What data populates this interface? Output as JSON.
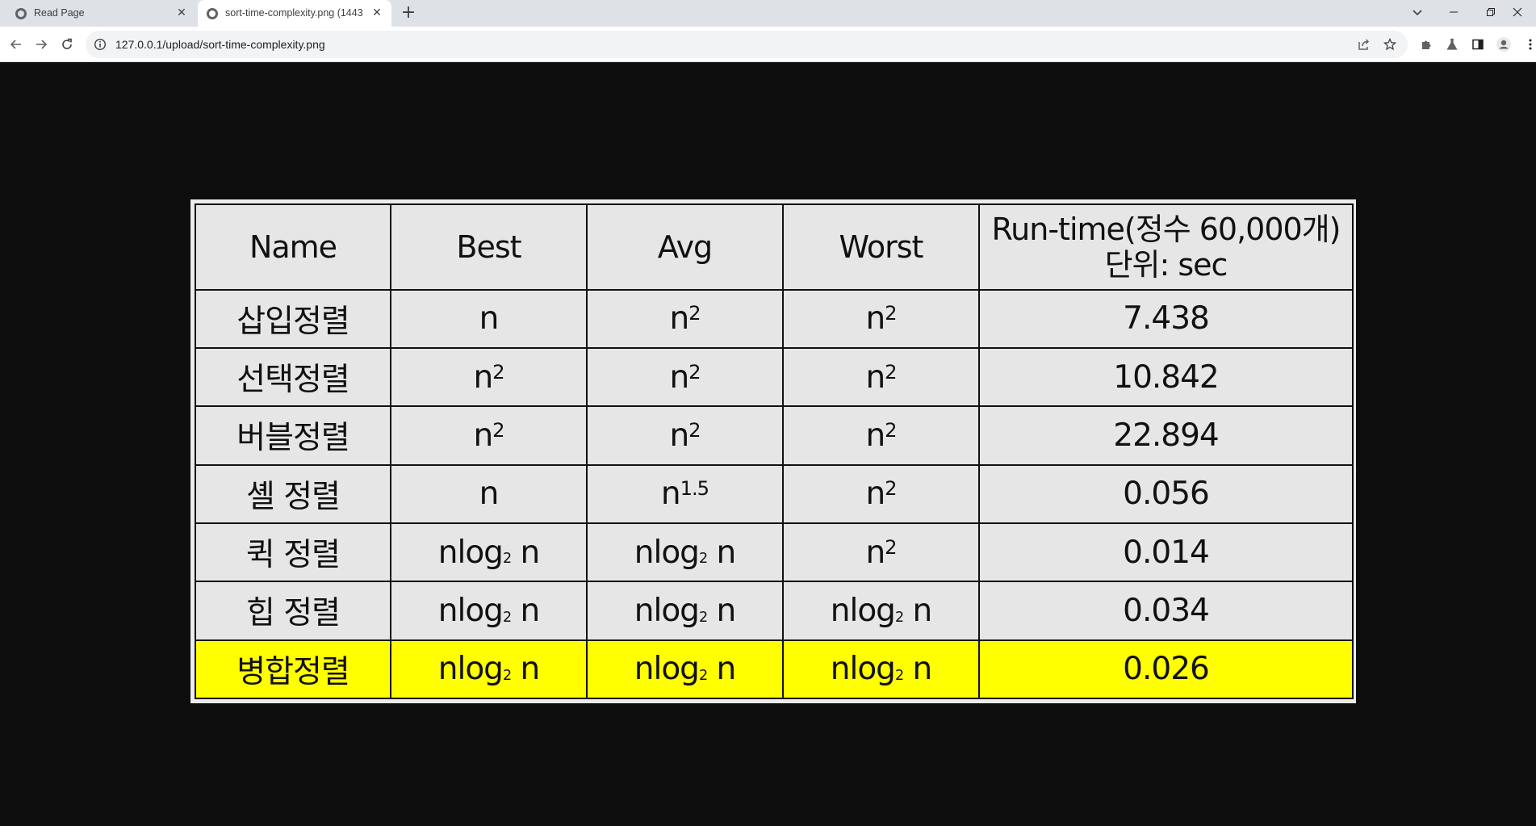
{
  "browser": {
    "tabs": [
      {
        "title": "Read Page",
        "active": false
      },
      {
        "title": "sort-time-complexity.png (1443",
        "active": true
      }
    ],
    "url": "127.0.0.1/upload/sort-time-complexity.png",
    "icons": {
      "favicon": "globe-icon",
      "back": "arrow-left-icon",
      "forward": "arrow-right-icon",
      "reload": "reload-icon",
      "info": "info-icon",
      "share": "share-icon",
      "bookmark": "star-icon",
      "extensions": "puzzle-icon",
      "labs": "flask-icon",
      "sidepanel": "side-panel-icon",
      "profile": "profile-icon",
      "menu": "kebab-menu-icon"
    }
  },
  "table": {
    "headers": {
      "name": "Name",
      "best": "Best",
      "avg": "Avg",
      "worst": "Worst",
      "runtime_line1": "Run-time(정수 60,000개)",
      "runtime_line2": "단위: sec"
    },
    "rows": [
      {
        "name": "삽입정렬",
        "best": {
          "base": "n",
          "sup": ""
        },
        "avg": {
          "base": "n",
          "sup": "2"
        },
        "worst": {
          "base": "n",
          "sup": "2"
        },
        "runtime": "7.438",
        "highlight": false
      },
      {
        "name": "선택정렬",
        "best": {
          "base": "n",
          "sup": "2"
        },
        "avg": {
          "base": "n",
          "sup": "2"
        },
        "worst": {
          "base": "n",
          "sup": "2"
        },
        "runtime": "10.842",
        "highlight": false
      },
      {
        "name": "버블정렬",
        "best": {
          "base": "n",
          "sup": "2"
        },
        "avg": {
          "base": "n",
          "sup": "2"
        },
        "worst": {
          "base": "n",
          "sup": "2"
        },
        "runtime": "22.894",
        "highlight": false
      },
      {
        "name": "셸 정렬",
        "best": {
          "base": "n",
          "sup": ""
        },
        "avg": {
          "base": "n",
          "sup": "1.5"
        },
        "worst": {
          "base": "n",
          "sup": "2"
        },
        "runtime": "0.056",
        "highlight": false
      },
      {
        "name": "퀵 정렬",
        "best": {
          "log": true
        },
        "avg": {
          "log": true
        },
        "worst": {
          "base": "n",
          "sup": "2"
        },
        "runtime": "0.014",
        "highlight": false
      },
      {
        "name": "힙 정렬",
        "best": {
          "log": true
        },
        "avg": {
          "log": true
        },
        "worst": {
          "log": true
        },
        "runtime": "0.034",
        "highlight": false
      },
      {
        "name": "병합정렬",
        "best": {
          "log": true
        },
        "avg": {
          "log": true
        },
        "worst": {
          "log": true
        },
        "runtime": "0.026",
        "highlight": true
      }
    ],
    "log_parts": {
      "pre": "nlog",
      "sub": "2",
      "post": " n"
    },
    "colors": {
      "highlight": "#ffff00",
      "cell": "#e6e6e6",
      "border": "#111111"
    }
  }
}
